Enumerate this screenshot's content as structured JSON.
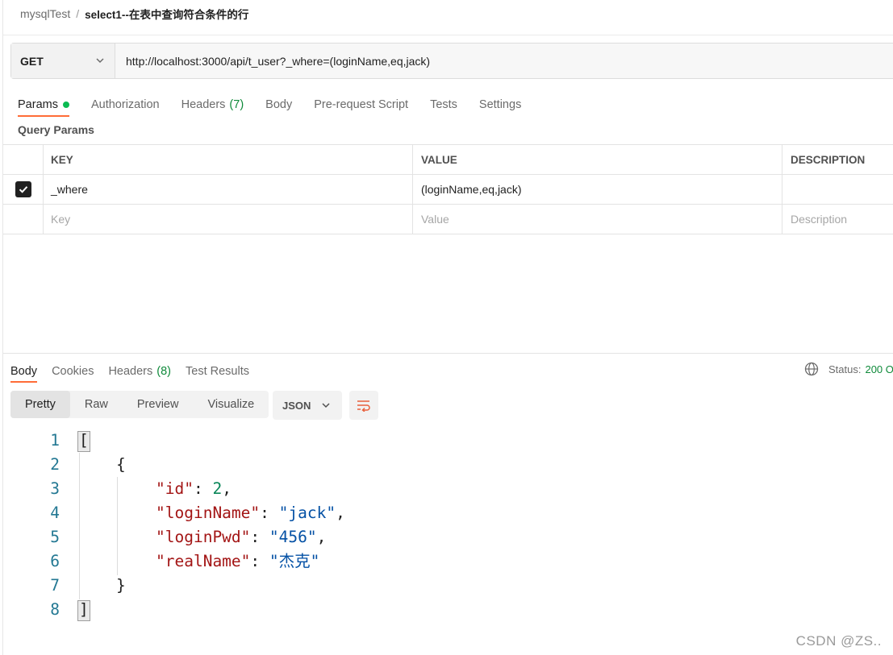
{
  "breadcrumb": {
    "collection": "mysqlTest",
    "separator": "/",
    "request": "select1--在表中查询符合条件的行"
  },
  "request": {
    "method": "GET",
    "url": "http://localhost:3000/api/t_user?_where=(loginName,eq,jack)",
    "tabs": [
      "Params",
      "Authorization",
      "Headers",
      "Body",
      "Pre-request Script",
      "Tests",
      "Settings"
    ],
    "headers_count": "(7)",
    "active_tab": "Params",
    "params_dot_color": "#0cbb52"
  },
  "query_params": {
    "title": "Query Params",
    "columns": [
      "KEY",
      "VALUE",
      "DESCRIPTION"
    ],
    "rows": [
      {
        "checked": true,
        "key": "_where",
        "value": "(loginName,eq,jack)",
        "description": ""
      }
    ],
    "placeholders": {
      "key": "Key",
      "value": "Value",
      "description": "Description"
    }
  },
  "response": {
    "tabs": [
      "Body",
      "Cookies",
      "Headers",
      "Test Results"
    ],
    "headers_count": "(8)",
    "active_tab": "Body",
    "status_label": "Status:",
    "status_value": "200 O",
    "format_modes": [
      "Pretty",
      "Raw",
      "Preview",
      "Visualize"
    ],
    "active_mode": "Pretty",
    "language": "JSON",
    "icons": {
      "globe": "globe-icon",
      "wrap": "wrap-lines-icon",
      "chevron": "chevron-down-icon"
    },
    "line_numbers": [
      "1",
      "2",
      "3",
      "4",
      "5",
      "6",
      "7",
      "8"
    ],
    "json": {
      "open_array": "[",
      "open_obj": "{",
      "id_key": "\"id\"",
      "id_value": "2",
      "loginName_key": "\"loginName\"",
      "loginName_value": "\"jack\"",
      "loginPwd_key": "\"loginPwd\"",
      "loginPwd_value": "\"456\"",
      "realName_key": "\"realName\"",
      "realName_value": "\"杰克\"",
      "close_obj": "}",
      "close_array": "]"
    }
  },
  "colors": {
    "accent": "#ff6c37",
    "success": "#0f8a3a",
    "line_number": "#237893",
    "json_key": "#a31515",
    "json_string": "#0451a5",
    "json_number": "#098658"
  },
  "watermark": "CSDN @ZS.."
}
